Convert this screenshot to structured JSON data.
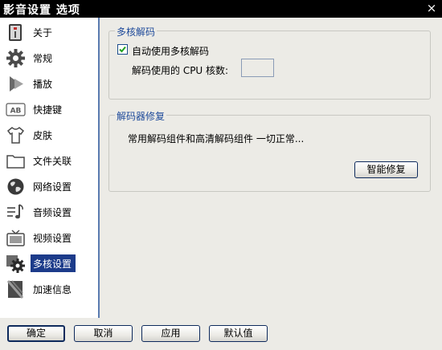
{
  "window": {
    "title": "影音设置 选项",
    "close_glyph": "×"
  },
  "sidebar": {
    "items": [
      {
        "label": "关于",
        "icon": "info-book-icon"
      },
      {
        "label": "常规",
        "icon": "gear-icon"
      },
      {
        "label": "播放",
        "icon": "play-arrow-icon"
      },
      {
        "label": "快捷键",
        "icon": "keyboard-key-icon"
      },
      {
        "label": "皮肤",
        "icon": "tshirt-icon"
      },
      {
        "label": "文件关联",
        "icon": "folder-icon"
      },
      {
        "label": "网络设置",
        "icon": "globe-icon"
      },
      {
        "label": "音频设置",
        "icon": "music-note-icon"
      },
      {
        "label": "视频设置",
        "icon": "tv-icon"
      },
      {
        "label": "多核设置",
        "icon": "cpu-gears-icon",
        "active": true
      },
      {
        "label": "加速信息",
        "icon": "acceleration-icon"
      }
    ]
  },
  "multicore": {
    "legend": "多核解码",
    "auto_checkbox_label": "自动使用多核解码",
    "auto_checked": true,
    "cores_label": "解码使用的 CPU 核数:",
    "cores_value": ""
  },
  "repair": {
    "legend": "解码器修复",
    "status": "常用解码组件和高清解码组件 一切正常...",
    "fix_button": "智能修复"
  },
  "footer": {
    "ok": "确定",
    "cancel": "取消",
    "apply": "应用",
    "defaults": "默认值"
  },
  "colors": {
    "accent": "#1c3b8a",
    "legend_text": "#1e4a9a",
    "title_bar": "#000000"
  }
}
